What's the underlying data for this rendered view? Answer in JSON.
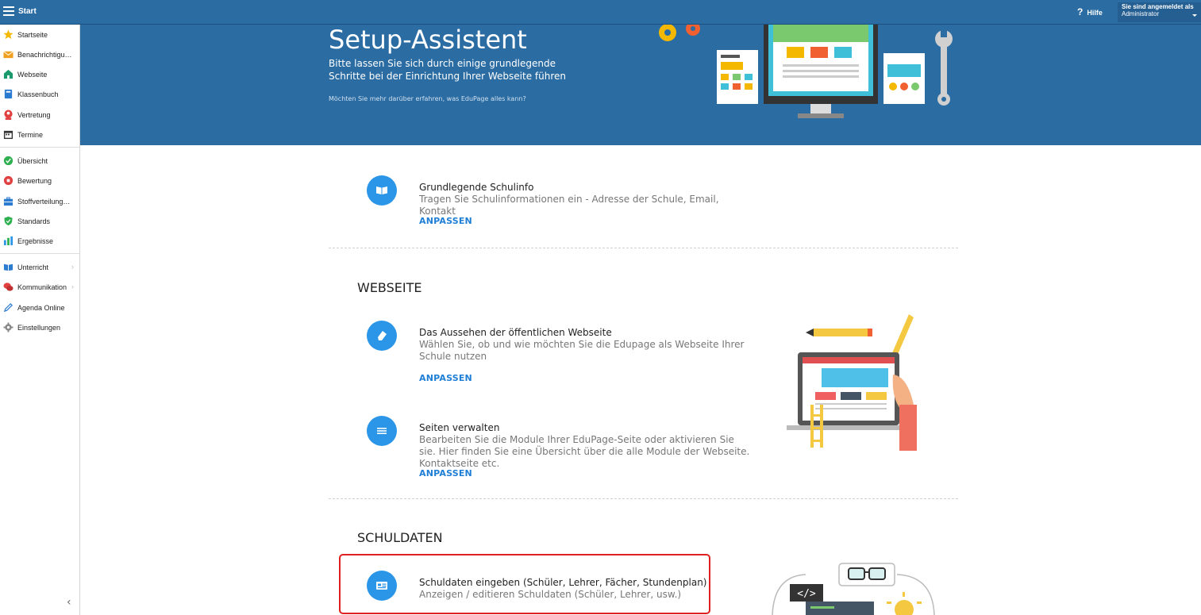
{
  "topbar": {
    "title": "Start",
    "help_label": "Hilfe",
    "user_line1": "Sie sind angemeldet als",
    "user_line2": "Administrator"
  },
  "sidebar": {
    "items": [
      {
        "label": "Startseite",
        "icon": "star-icon",
        "color": "#f5b800"
      },
      {
        "label": "Benachrichtigungen",
        "icon": "envelope-icon",
        "color": "#f0a020"
      },
      {
        "label": "Webseite",
        "icon": "home-icon",
        "color": "#1a9a6c"
      },
      {
        "label": "Klassenbuch",
        "icon": "book-icon",
        "color": "#2b7bd0"
      },
      {
        "label": "Vertretung",
        "icon": "person-icon",
        "color": "#e04040"
      },
      {
        "label": "Termine",
        "icon": "calendar-icon",
        "color": "#333333"
      },
      {
        "label": "Übersicht",
        "icon": "check-circle-icon",
        "color": "#2fb050"
      },
      {
        "label": "Bewertung",
        "icon": "grade-icon",
        "color": "#e04040"
      },
      {
        "label": "Stoffverteilungsplan",
        "icon": "briefcase-icon",
        "color": "#2b7bd0"
      },
      {
        "label": "Standards",
        "icon": "shield-icon",
        "color": "#2fb050"
      },
      {
        "label": "Ergebnisse",
        "icon": "bar-chart-icon",
        "color": "#2b96e8"
      },
      {
        "label": "Unterricht",
        "icon": "open-book-icon",
        "color": "#2b7bd0"
      },
      {
        "label": "Kommunikation",
        "icon": "chat-icon",
        "color": "#e04040"
      },
      {
        "label": "Agenda Online",
        "icon": "pen-icon",
        "color": "#2b7bd0"
      },
      {
        "label": "Einstellungen",
        "icon": "gear-icon",
        "color": "#888888"
      }
    ]
  },
  "hero": {
    "title": "Setup-Assistent",
    "subtitle": "Bitte lassen Sie sich durch einige grundlegende Schritte bei der Einrichtung Ihrer Webseite führen",
    "more_link": "Möchten Sie mehr darüber erfahren, was EduPage alles kann?"
  },
  "tasks": {
    "schulinfo": {
      "title": "Grundlegende Schulinfo",
      "desc": "Tragen Sie Schulinformationen ein - Adresse der Schule, Email, Kontakt",
      "action": "ANPASSEN"
    },
    "aussehen": {
      "title": "Das Aussehen der öffentlichen Webseite",
      "desc": "Wählen Sie, ob und wie möchten Sie die Edupage als Webseite Ihrer Schule nutzen",
      "action": "ANPASSEN"
    },
    "seiten": {
      "title": "Seiten verwalten",
      "desc": "Bearbeiten Sie die Module Ihrer EduPage-Seite oder aktivieren Sie sie. Hier finden Sie eine Übersicht über die alle Module der Webseite. Kontaktseite etc.",
      "action": "ANPASSEN"
    },
    "schuldaten": {
      "title": "Schuldaten eingeben (Schüler, Lehrer, Fächer, Stundenplan)",
      "desc": "Anzeigen / editieren Schuldaten (Schüler, Lehrer, usw.)"
    }
  },
  "sections": {
    "webseite": "WEBSEITE",
    "schuldaten": "SCHULDATEN"
  }
}
